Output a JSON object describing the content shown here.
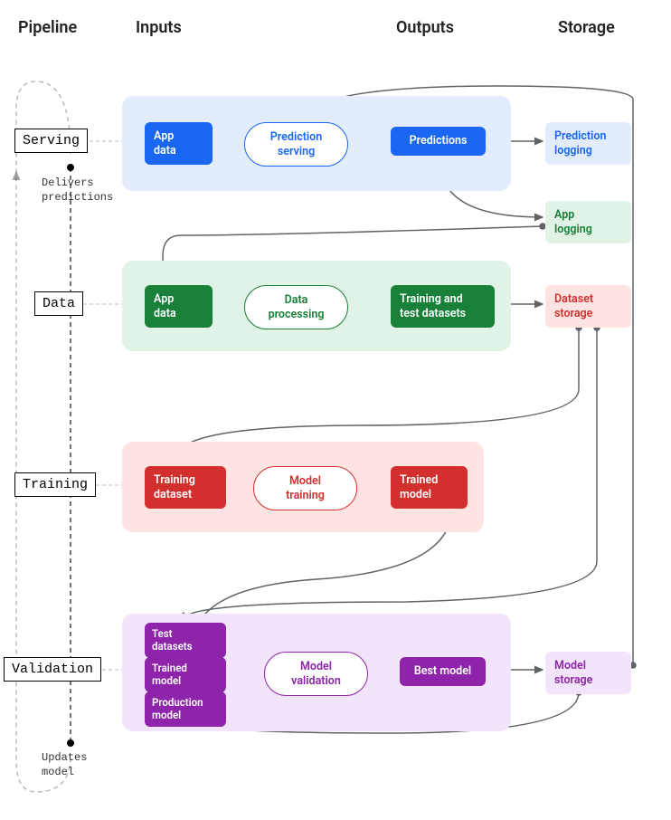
{
  "headers": {
    "pipeline": "Pipeline",
    "inputs": "Inputs",
    "outputs": "Outputs",
    "storage": "Storage"
  },
  "annotations": {
    "delivers": "Delivers\npredictions",
    "updates": "Updates\nmodel"
  },
  "rows": {
    "serving": {
      "label": "Serving",
      "input": "App\ndata",
      "process": "Prediction\nserving",
      "output": "Predictions",
      "storage": "Prediction\nlogging"
    },
    "data": {
      "label": "Data",
      "input": "App\ndata",
      "process": "Data\nprocessing",
      "output": "Training and\ntest datasets",
      "storage": "Dataset\nstorage",
      "extraStorage": "App\nlogging"
    },
    "training": {
      "label": "Training",
      "input": "Training\ndataset",
      "process": "Model\ntraining",
      "output": "Trained\nmodel"
    },
    "validation": {
      "label": "Validation",
      "inputs": [
        "Test\ndatasets",
        "Trained\nmodel",
        "Production\nmodel"
      ],
      "process": "Model\nvalidation",
      "output": "Best model",
      "storage": "Model\nstorage"
    }
  },
  "colors": {
    "blue": "#1967f2",
    "green": "#188038",
    "red": "#d32f2f",
    "purple": "#8e24aa",
    "arrow": "#5f6368"
  }
}
